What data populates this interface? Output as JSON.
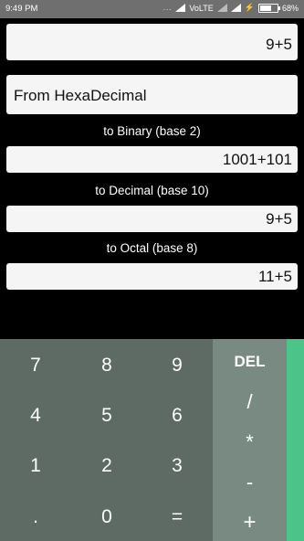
{
  "status_bar": {
    "time": "9:49 PM",
    "dots": "...",
    "network": "VoLTE",
    "battery_percent": "68%",
    "battery_level": 0.68
  },
  "input": {
    "value": "9+5"
  },
  "from_base": {
    "selected": "From HexaDecimal"
  },
  "outputs": {
    "binary": {
      "label": "to Binary (base 2)",
      "value": "1001+101"
    },
    "decimal": {
      "label": "to Decimal (base 10)",
      "value": "9+5"
    },
    "octal": {
      "label": "to Octal (base 8)",
      "value": "11+5"
    }
  },
  "keypad": {
    "rows": [
      [
        "7",
        "8",
        "9"
      ],
      [
        "4",
        "5",
        "6"
      ],
      [
        "1",
        "2",
        "3"
      ],
      [
        ".",
        "0",
        "="
      ]
    ],
    "ops": [
      "DEL",
      "/",
      "*",
      "-",
      "+"
    ]
  },
  "colors": {
    "numpad_bg": "#5d6b64",
    "ops_bg": "#798a82",
    "drawer_accent": "#4cc489",
    "status_bar_bg": "#6f6f6f"
  }
}
